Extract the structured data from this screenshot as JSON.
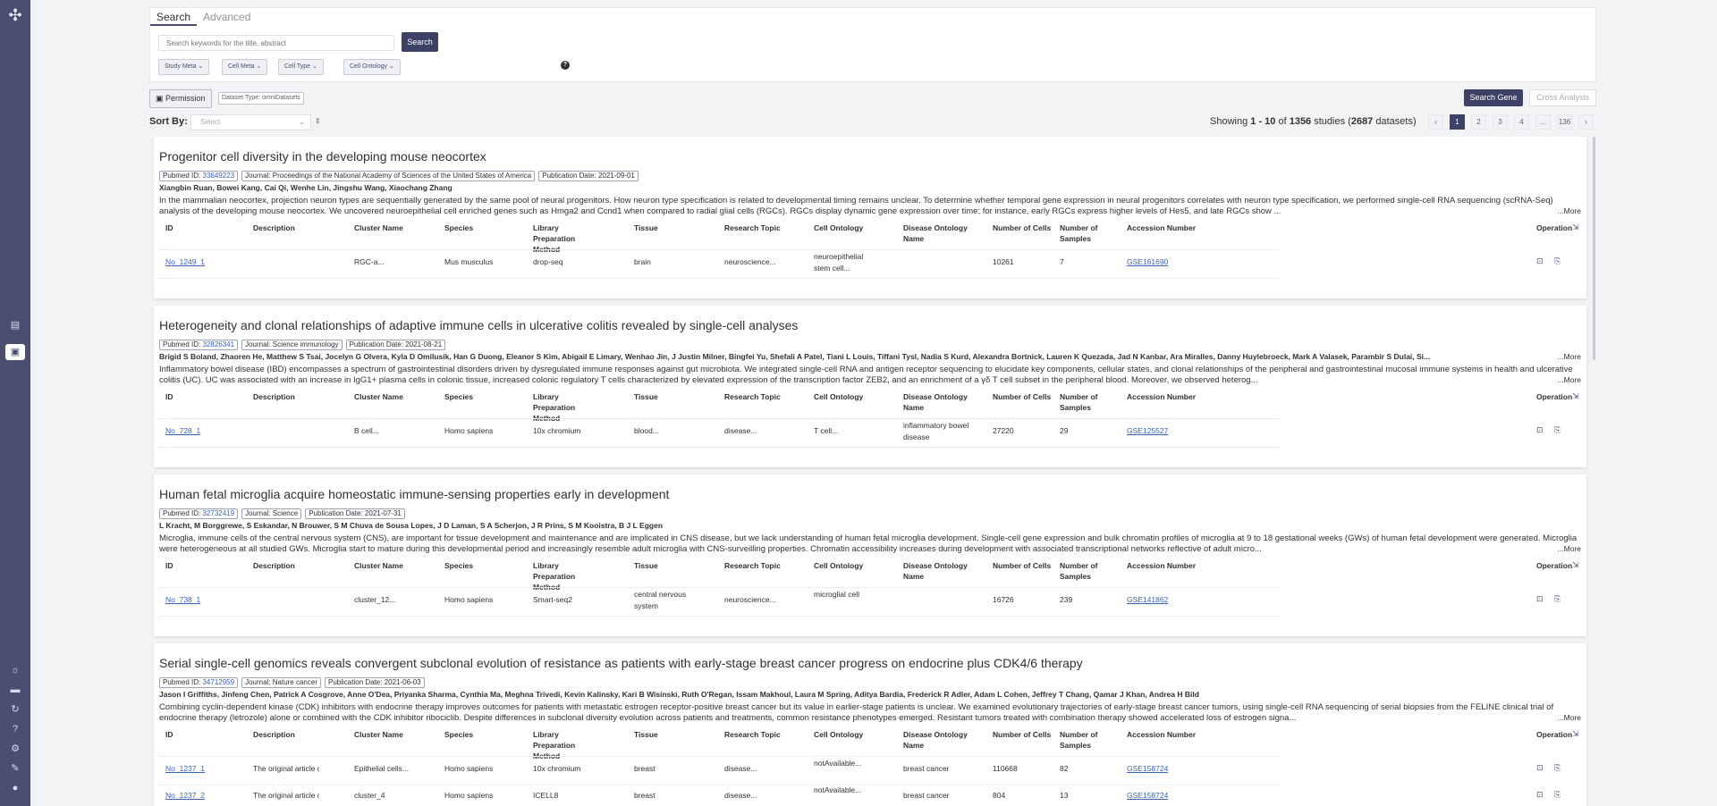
{
  "sidebar": {
    "logo": "omnibrowser-logo",
    "icons": [
      "dataset-icon",
      "browse-icon",
      "settings-icon",
      "document-icon",
      "history-icon",
      "help-icon",
      "tools-icon",
      "feedback-icon",
      "user-icon"
    ]
  },
  "search": {
    "tabs": [
      "Search",
      "Advanced"
    ],
    "placeholder": "Search keywords for the title, abstract",
    "button": "Search",
    "filters": [
      "Study Meta",
      "Cell Meta",
      "Cell Type",
      "Cell Ontology"
    ]
  },
  "toolbar": {
    "permission": "Permission",
    "dataset_type": "Dataset Type: omniDatasets",
    "search_gene": "Search Gene",
    "cross_analysis": "Cross Analysis",
    "sort_label": "Sort By:",
    "sort_placeholder": "Select",
    "showing_prefix": "Showing ",
    "showing_range": "1 - 10",
    "showing_of": " of ",
    "showing_total": "1356",
    "showing_studies": " studies (",
    "showing_datasets": "2687",
    "showing_suffix": " datasets)",
    "pages": [
      "‹",
      "1",
      "2",
      "3",
      "4",
      "…",
      "136",
      "›"
    ]
  },
  "table_headers": [
    "ID",
    "Description",
    "Cluster Name",
    "Species",
    "Library Preparation Method",
    "Tissue",
    "Research Topic",
    "Cell Ontology",
    "Disease Ontology Name",
    "Number of Cells",
    "Number of Samples",
    "Accession Number",
    "Operation"
  ],
  "more_label": "...More",
  "studies": [
    {
      "title": "Progenitor cell diversity in the developing mouse neocortex",
      "pubmed_label": "Pubmed ID: ",
      "pubmed_id": "33649223",
      "journal": "Journal: Proceedings of the National Academy of Sciences of the United States of America",
      "date": "Publication Date: 2021-09-01",
      "authors": "Xiangbin Ruan, Bowei Kang, Cai Qi, Wenhe Lin, Jingshu Wang, Xiaochang Zhang",
      "abstract": "In the mammalian neocortex, projection neuron types are sequentially generated by the same pool of neural progenitors. How neuron type specification is related to developmental timing remains unclear. To determine whether temporal gene expression in neural progenitors correlates with neuron type specification, we performed single-cell RNA sequencing (scRNA-Seq) analysis of the developing mouse neocortex. We uncovered neuroepithelial cell enriched genes such as Hmga2 and Ccnd1 when compared to radial glial cells (RGCs). RGCs display dynamic gene expression over time; for instance, early RGCs express higher levels of Hes5, and late RGCs show ...",
      "rows": [
        {
          "id": "No_1249_1",
          "desc": "",
          "cluster": "RGC-a...",
          "species": "Mus musculus",
          "lib": "drop-seq",
          "tissue": "brain",
          "topic": "neuroscience...",
          "ontology": "neuroepithelial stem cell...",
          "disease": "",
          "cells": "10261",
          "samples": "7",
          "accession": "GSE161690"
        }
      ]
    },
    {
      "title": "Heterogeneity and clonal relationships of adaptive immune cells in ulcerative colitis revealed by single-cell analyses",
      "pubmed_label": "Pubmed ID: ",
      "pubmed_id": "32826341",
      "journal": "Journal: Science immunology",
      "date": "Publication Date: 2021-08-21",
      "authors": "Brigid S Boland, Zhaoren He, Matthew S Tsai, Jocelyn G Olvera, Kyla D Omilusik, Han G Duong, Eleanor S Kim, Abigail E Limary, Wenhao Jin, J Justin Milner, Bingfei Yu, Shefali A Patel, Tiani L Louis, Tiffani Tysl, Nadia S Kurd, Alexandra Bortnick, Lauren K Quezada, Jad N Kanbar, Ara Miralles, Danny Huylebroeck, Mark A Valasek, Parambir S Dulai, Si...",
      "abstract": "Inflammatory bowel disease (IBD) encompasses a spectrum of gastrointestinal disorders driven by dysregulated immune responses against gut microbiota. We integrated single-cell RNA and antigen receptor sequencing to elucidate key components, cellular states, and clonal relationships of the peripheral and gastrointestinal mucosal immune systems in health and ulcerative colitis (UC). UC was associated with an increase in IgG1+ plasma cells in colonic tissue, increased colonic regulatory T cells characterized by elevated expression of the transcription factor ZEB2, and an enrichment of a γδ T cell subset in the peripheral blood. Moreover, we observed heterog...",
      "rows": [
        {
          "id": "No_728_1",
          "desc": "",
          "cluster": "B cell...",
          "species": "Homo sapiens",
          "lib": "10x chromium",
          "tissue": "blood...",
          "topic": "disease...",
          "ontology": "T cell...",
          "disease": "inflammatory bowel disease",
          "cells": "27220",
          "samples": "29",
          "accession": "GSE125527"
        }
      ]
    },
    {
      "title": "Human fetal microglia acquire homeostatic immune-sensing properties early in development",
      "pubmed_label": "Pubmed ID: ",
      "pubmed_id": "32732419",
      "journal": "Journal: Science",
      "date": "Publication Date: 2021-07-31",
      "authors": "L Kracht, M Borggrewe, S Eskandar, N Brouwer, S M Chuva de Sousa Lopes, J D Laman, S A Scherjon, J R Prins, S M Kooistra, B J L Eggen",
      "abstract": "Microglia, immune cells of the central nervous system (CNS), are important for tissue development and maintenance and are implicated in CNS disease, but we lack understanding of human fetal microglia development. Single-cell gene expression and bulk chromatin profiles of microglia at 9 to 18 gestational weeks (GWs) of human fetal development were generated. Microglia were heterogeneous at all studied GWs. Microglia start to mature during this developmental period and increasingly resemble adult microglia with CNS-surveilling properties. Chromatin accessibility increases during development with associated transcriptional networks reflective of adult micro...",
      "rows": [
        {
          "id": "No_738_1",
          "desc": "",
          "cluster": "cluster_12...",
          "species": "Homo sapiens",
          "lib": "Smart-seq2",
          "tissue": "central nervous system",
          "topic": "neuroscience...",
          "ontology": "microglial cell",
          "disease": "",
          "cells": "16726",
          "samples": "239",
          "accession": "GSE141862"
        }
      ]
    },
    {
      "title": "Serial single-cell genomics reveals convergent subclonal evolution of resistance as patients with early-stage breast cancer progress on endocrine plus CDK4/6 therapy",
      "pubmed_label": "Pubmed ID: ",
      "pubmed_id": "34712959",
      "journal": "Journal: Nature cancer",
      "date": "Publication Date: 2021-06-03",
      "authors": "Jason I Griffiths, Jinfeng Chen, Patrick A Cosgrove, Anne O'Dea, Priyanka Sharma, Cynthia Ma, Meghna Trivedi, Kevin Kalinsky, Kari B Wisinski, Ruth O'Regan, Issam Makhoul, Laura M Spring, Aditya Bardia, Frederick R Adler, Adam L Cohen, Jeffrey T Chang, Qamar J Khan, Andrea H Bild",
      "abstract": "Combining cyclin-dependent kinase (CDK) inhibitors with endocrine therapy improves outcomes for patients with metastatic estrogen receptor-positive breast cancer but its value in earlier-stage patients is unclear. We examined evolutionary trajectories of early-stage breast cancer tumors, using single-cell RNA sequencing of serial biopsies from the FELINE clinical trial of endocrine therapy (letrozole) alone or combined with the CDK inhibitor ribociclib. Despite differences in subclonal diversity evolution across patients and treatments, common resistance phenotypes emerged. Resistant tumors treated with combination therapy showed accelerated loss of estrogen signa...",
      "rows": [
        {
          "id": "No_1237_1",
          "desc": "The original article con...",
          "cluster": "Epithelial cells...",
          "species": "Homo sapiens",
          "lib": "10x chromium",
          "tissue": "breast",
          "topic": "disease...",
          "ontology": "notAvailable...",
          "disease": "breast cancer",
          "cells": "110668",
          "samples": "82",
          "accession": "GSE158724"
        },
        {
          "id": "No_1237_2",
          "desc": "The original article con...",
          "cluster": "cluster_4",
          "species": "Homo sapiens",
          "lib": "ICELL8",
          "tissue": "breast",
          "topic": "disease...",
          "ontology": "notAvailable...",
          "disease": "breast cancer",
          "cells": "804",
          "samples": "13",
          "accession": "GSE158724"
        }
      ]
    }
  ]
}
